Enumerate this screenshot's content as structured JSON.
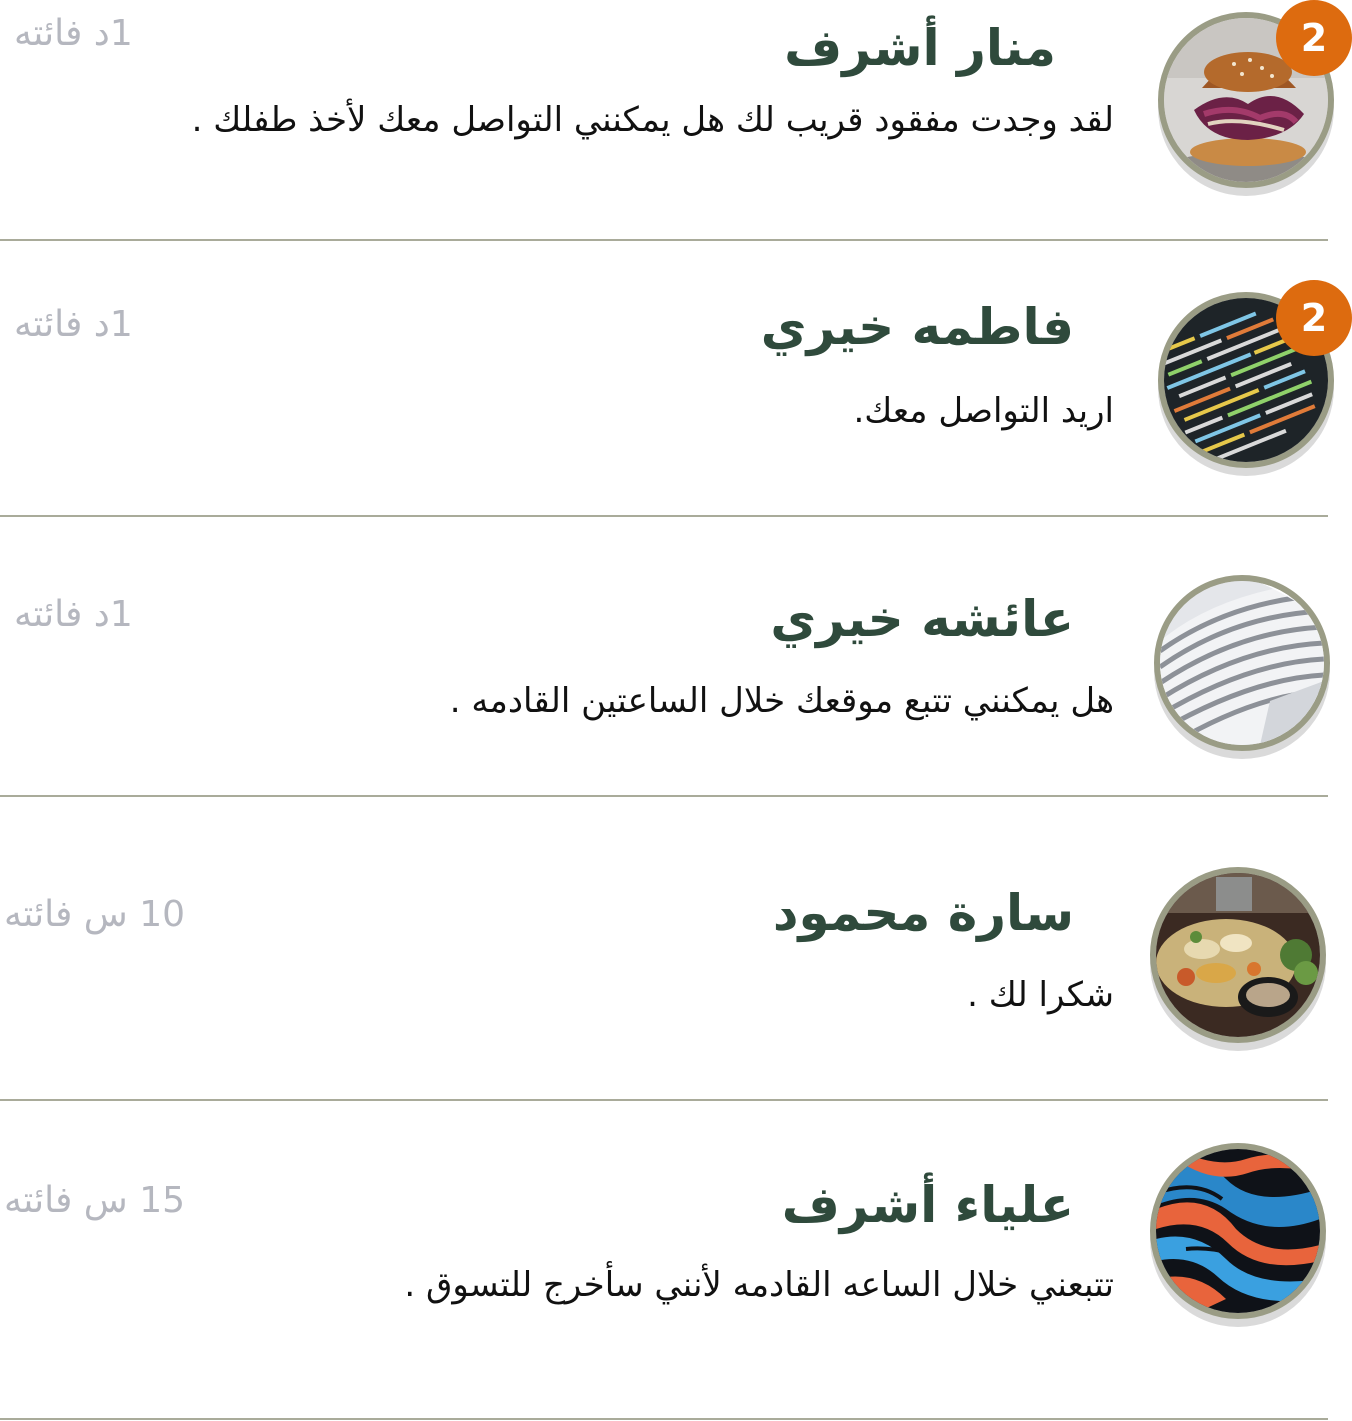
{
  "conversations": [
    {
      "name": "منار أشرف",
      "message": "لقد وجدت مفقود قريب لك هل يمكنني التواصل معك لأخذ طفلك .",
      "time": "1د فائته",
      "unread": "2",
      "avatar": "burger-photo"
    },
    {
      "name": "فاطمه خيري",
      "message": "اريد التواصل معك.",
      "time": "1د فائته",
      "unread": "2",
      "avatar": "code-screen-photo"
    },
    {
      "name": "عائشه خيري",
      "message": "هل يمكنني تتبع موقعك خلال الساعتين القادمه .",
      "time": "1د فائته",
      "avatar": "architecture-photo"
    },
    {
      "name": "سارة محمود",
      "message": "شكرا لك .",
      "time": "10 س فائته",
      "avatar": "food-plate-photo"
    },
    {
      "name": "علياء أشرف",
      "message": "تتبعني خلال الساعه القادمه لأنني سأخرج للتسوق .",
      "time": "15 س فائته",
      "avatar": "abstract-paint-photo"
    }
  ],
  "colors": {
    "name_text": "#2f4a3c",
    "message_text": "#111111",
    "time_text": "#b5b7bf",
    "badge": "#dd6b0f",
    "avatar_ring": "#9a9c85",
    "divider": "#a9ab9a"
  }
}
